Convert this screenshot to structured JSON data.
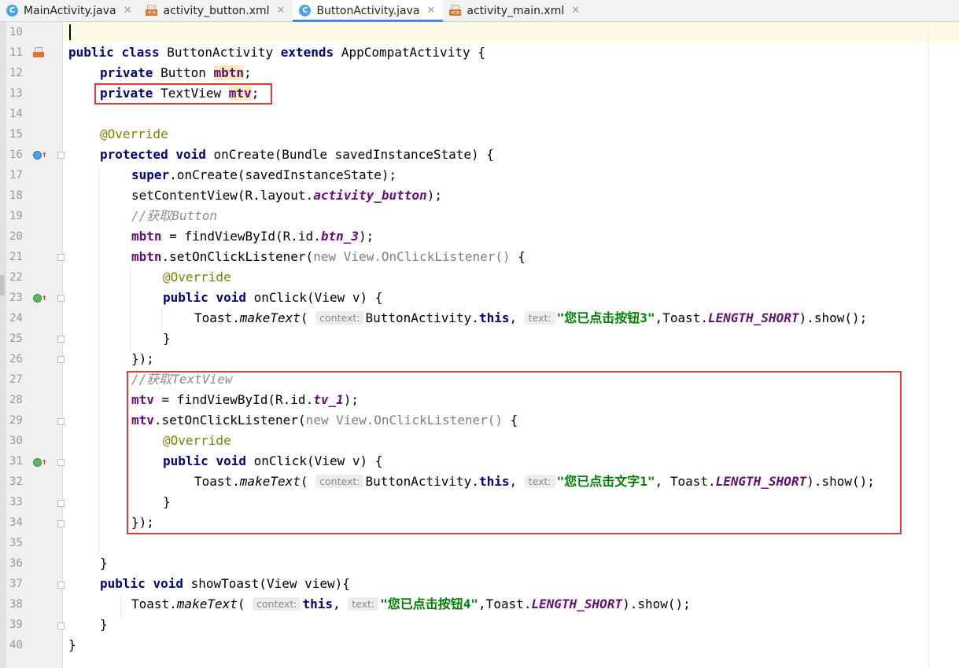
{
  "tabs": [
    {
      "label": "MainActivity.java",
      "type": "java"
    },
    {
      "label": "activity_button.xml",
      "type": "xml"
    },
    {
      "label": "ButtonActivity.java",
      "type": "java",
      "active": true
    },
    {
      "label": "activity_main.xml",
      "type": "xml"
    }
  ],
  "close_glyph": "✕",
  "line_numbers": [
    "10",
    "11",
    "12",
    "13",
    "14",
    "15",
    "16",
    "17",
    "18",
    "19",
    "20",
    "21",
    "22",
    "23",
    "24",
    "25",
    "26",
    "27",
    "28",
    "29",
    "30",
    "31",
    "32",
    "33",
    "34",
    "35",
    "36",
    "37",
    "38",
    "39",
    "40"
  ],
  "code": {
    "l11": {
      "kw1": "public",
      "kw2": "class",
      "name": "ButtonActivity",
      "kw3": "extends",
      "parent": "AppCompatActivity {"
    },
    "l12": {
      "kw": "private",
      "type": "Button",
      "field": "mbtn",
      "end": ";"
    },
    "l13": {
      "kw": "private",
      "type": "TextView",
      "field": "mtv",
      "end": ";"
    },
    "l15": {
      "ann": "@Override"
    },
    "l16": {
      "kw1": "protected",
      "kw2": "void",
      "rest": "onCreate(Bundle savedInstanceState) {"
    },
    "l17": {
      "kw": "super",
      "rest": ".onCreate(savedInstanceState);"
    },
    "l18": {
      "a": "setContentView(R.layout.",
      "b": "activity_button",
      "c": ");"
    },
    "l19": {
      "cm": "//获取Button"
    },
    "l20": {
      "f": "mbtn",
      "a": " = findViewById(R.id.",
      "b": "btn_3",
      "c": ");"
    },
    "l21": {
      "f": "mbtn",
      "a": ".setOnClickListener(",
      "kw": "new",
      "g": " View.OnClickListener()",
      "c": " {"
    },
    "l22": {
      "ann": "@Override"
    },
    "l23": {
      "kw1": "public",
      "kw2": "void",
      "rest": "onClick(View v) {"
    },
    "l24": {
      "a": "Toast.",
      "m": "makeText",
      "b": "( ",
      "h1": "context:",
      "c": "ButtonActivity.",
      "kw": "this",
      "d": ", ",
      "h2": "text:",
      "s": "\"您已点击按钮3\"",
      "e": ",Toast.",
      "k": "LENGTH_SHORT",
      "f": ").show();"
    },
    "l25": {
      "t": "}"
    },
    "l26": {
      "t": "});"
    },
    "l27": {
      "cm": "//获取TextView"
    },
    "l28": {
      "f": "mtv",
      "a": " = findViewById(R.id.",
      "b": "tv_1",
      "c": ");"
    },
    "l29": {
      "f": "mtv",
      "a": ".setOnClickListener(",
      "kw": "new",
      "g": " View.OnClickListener()",
      "c": " {"
    },
    "l30": {
      "ann": "@Override"
    },
    "l31": {
      "kw1": "public",
      "kw2": "void",
      "rest": "onClick(View v) {"
    },
    "l32": {
      "a": "Toast.",
      "m": "makeText",
      "b": "( ",
      "h1": "context:",
      "c": "ButtonActivity.",
      "kw": "this",
      "d": ", ",
      "h2": "text:",
      "s": "\"您已点击文字1\"",
      "e": ", Toast.",
      "k": "LENGTH_SHORT",
      "f": ").show();"
    },
    "l33": {
      "t": "}"
    },
    "l34": {
      "t": "});"
    },
    "l36": {
      "t": "}"
    },
    "l37": {
      "kw1": "public",
      "kw2": "void",
      "rest": "showToast(View view){"
    },
    "l38": {
      "a": "Toast.",
      "m": "makeText",
      "b": "( ",
      "h1": "context:",
      "kw": "this",
      "d": ", ",
      "h2": "text:",
      "s": "\"您已点击按钮4\"",
      "e": ",Toast.",
      "k": "LENGTH_SHORT",
      "f": ").show();"
    },
    "l39": {
      "t": "}"
    },
    "l40": {
      "t": "}"
    }
  },
  "colors": {
    "highlight_box": "#e53935",
    "active_tab_indicator": "#4a86e8",
    "keyword": "#000080",
    "string": "#008000",
    "annotation": "#808000"
  }
}
